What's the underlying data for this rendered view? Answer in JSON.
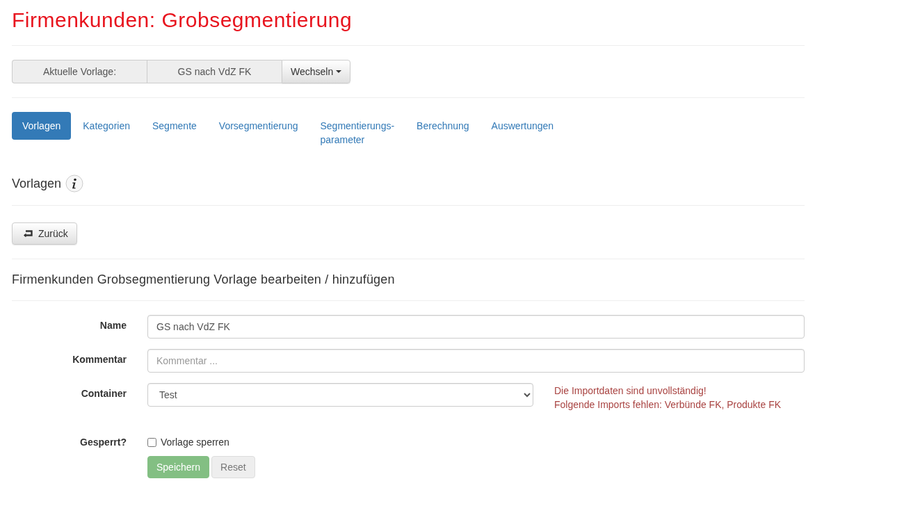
{
  "title": "Firmenkunden: Grobsegmentierung",
  "template_bar": {
    "label": "Aktuelle Vorlage:",
    "value": "GS nach VdZ FK",
    "switch_button": "Wechseln"
  },
  "tabs": [
    {
      "label": "Vorlagen",
      "selected": true
    },
    {
      "label": "Kategorien",
      "selected": false
    },
    {
      "label": "Segmente",
      "selected": false
    },
    {
      "label": "Vorsegmentierung",
      "selected": false
    },
    {
      "label": "Segmentierungs-\nparameter",
      "selected": false
    },
    {
      "label": "Berechnung",
      "selected": false
    },
    {
      "label": "Auswertungen",
      "selected": false
    }
  ],
  "section_title": "Vorlagen",
  "back_button": "Zurück",
  "form_title": "Firmenkunden Grobsegmentierung Vorlage bearbeiten / hinzufügen",
  "form": {
    "name": {
      "label": "Name",
      "value": "GS nach VdZ FK"
    },
    "comment": {
      "label": "Kommentar",
      "placeholder": "Kommentar ..."
    },
    "container": {
      "label": "Container",
      "value": "Test",
      "errors": [
        "Die Importdaten sind unvollständig!",
        "Folgende Imports fehlen: Verbünde FK, Produkte FK"
      ]
    },
    "locked": {
      "label": "Gesperrt?",
      "checkbox_label": "Vorlage sperren",
      "checked": false
    }
  },
  "buttons": [
    {
      "kind": "save",
      "label": "Speichern",
      "disabled": true
    },
    {
      "kind": "reset",
      "label": "Reset",
      "disabled": true
    }
  ]
}
